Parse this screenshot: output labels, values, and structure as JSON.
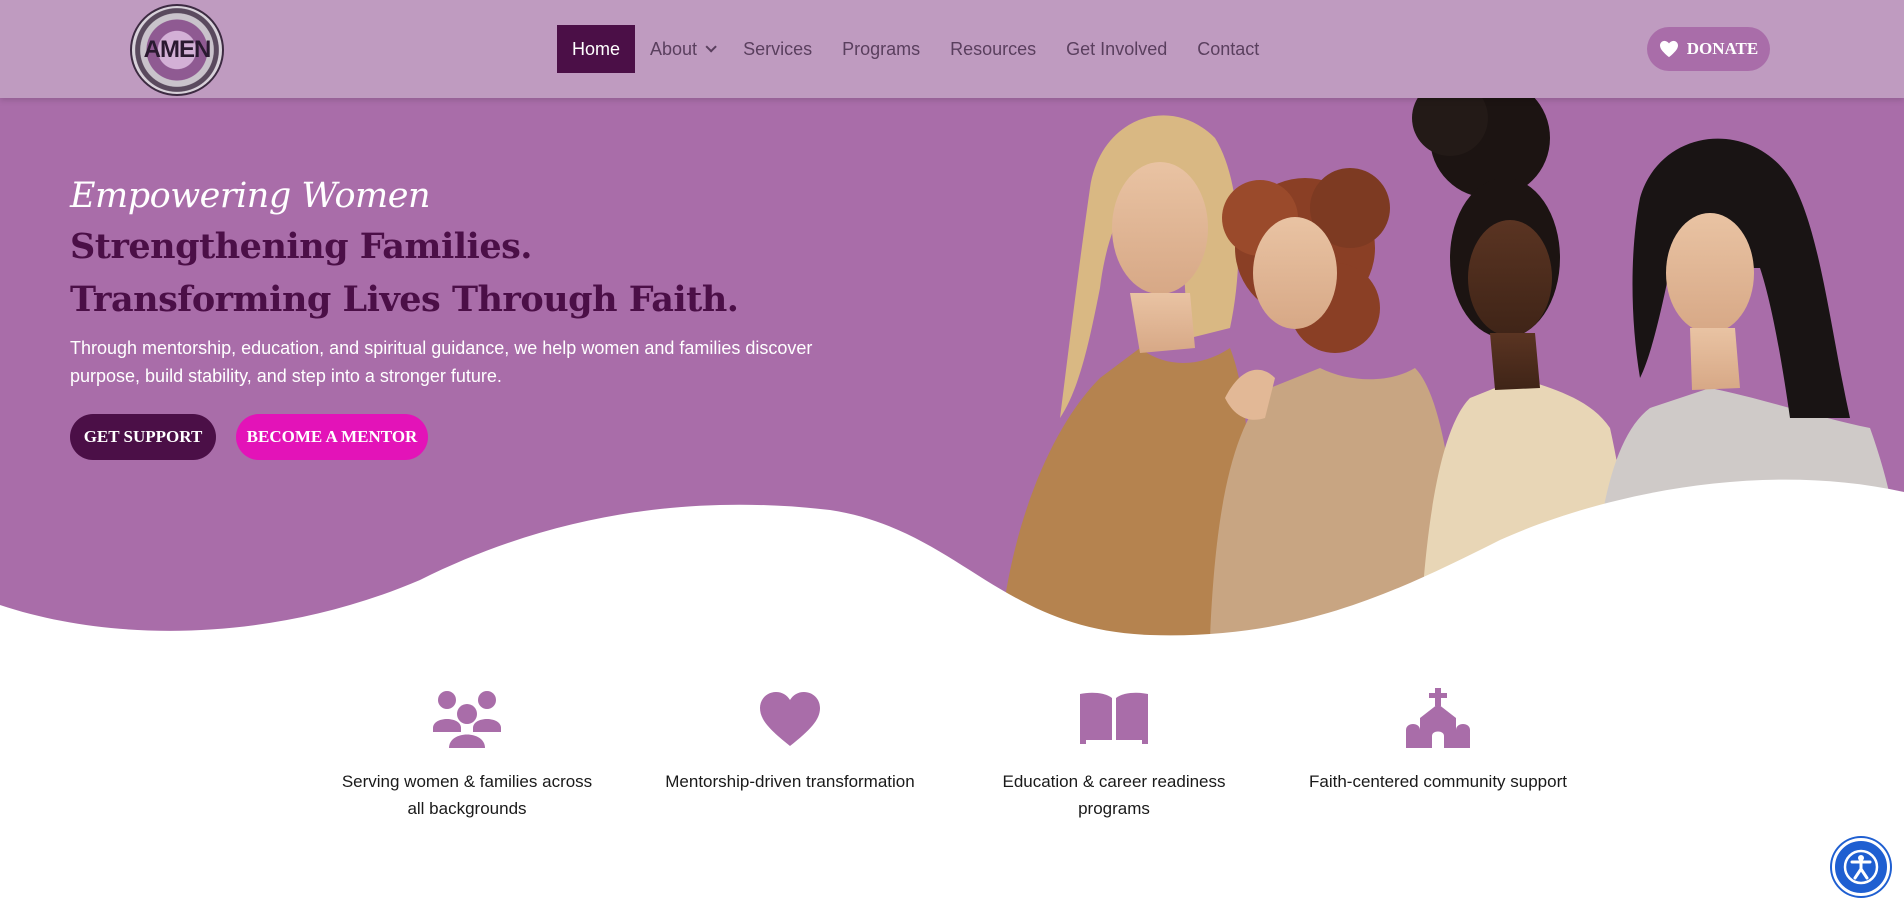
{
  "header": {
    "logo_text": "AMEN",
    "nav": [
      {
        "label": "Home",
        "active": true
      },
      {
        "label": "About",
        "dropdown": true
      },
      {
        "label": "Services"
      },
      {
        "label": "Programs"
      },
      {
        "label": "Resources"
      },
      {
        "label": "Get Involved"
      },
      {
        "label": "Contact"
      }
    ],
    "donate_label": "DONATE",
    "donate_icon": "heart-icon"
  },
  "hero": {
    "script_title": "Empowering Women",
    "line1": "Strengthening Families.",
    "line2": "Transforming Lives Through Faith.",
    "lead": "Through mentorship, education, and spiritual guidance, we help women and families discover purpose, build stability, and step into a stronger future.",
    "buttons": {
      "support": "GET SUPPORT",
      "mentor": "BECOME A MENTOR"
    }
  },
  "features": [
    {
      "icon": "people-group-icon",
      "text": "Serving women & families across all backgrounds"
    },
    {
      "icon": "heart-icon",
      "text": "Mentorship-driven transformation"
    },
    {
      "icon": "open-book-icon",
      "text": "Education & career readiness programs"
    },
    {
      "icon": "church-icon",
      "text": "Faith-centered community support"
    }
  ],
  "accessibility_button": {
    "icon": "accessibility-icon"
  },
  "colors": {
    "header_bg": "#bf9bc0",
    "hero_bg": "#a96da9",
    "brand_dark": "#4b0f47",
    "accent_pink": "#e313b8",
    "icon_purple": "#a96da9"
  }
}
